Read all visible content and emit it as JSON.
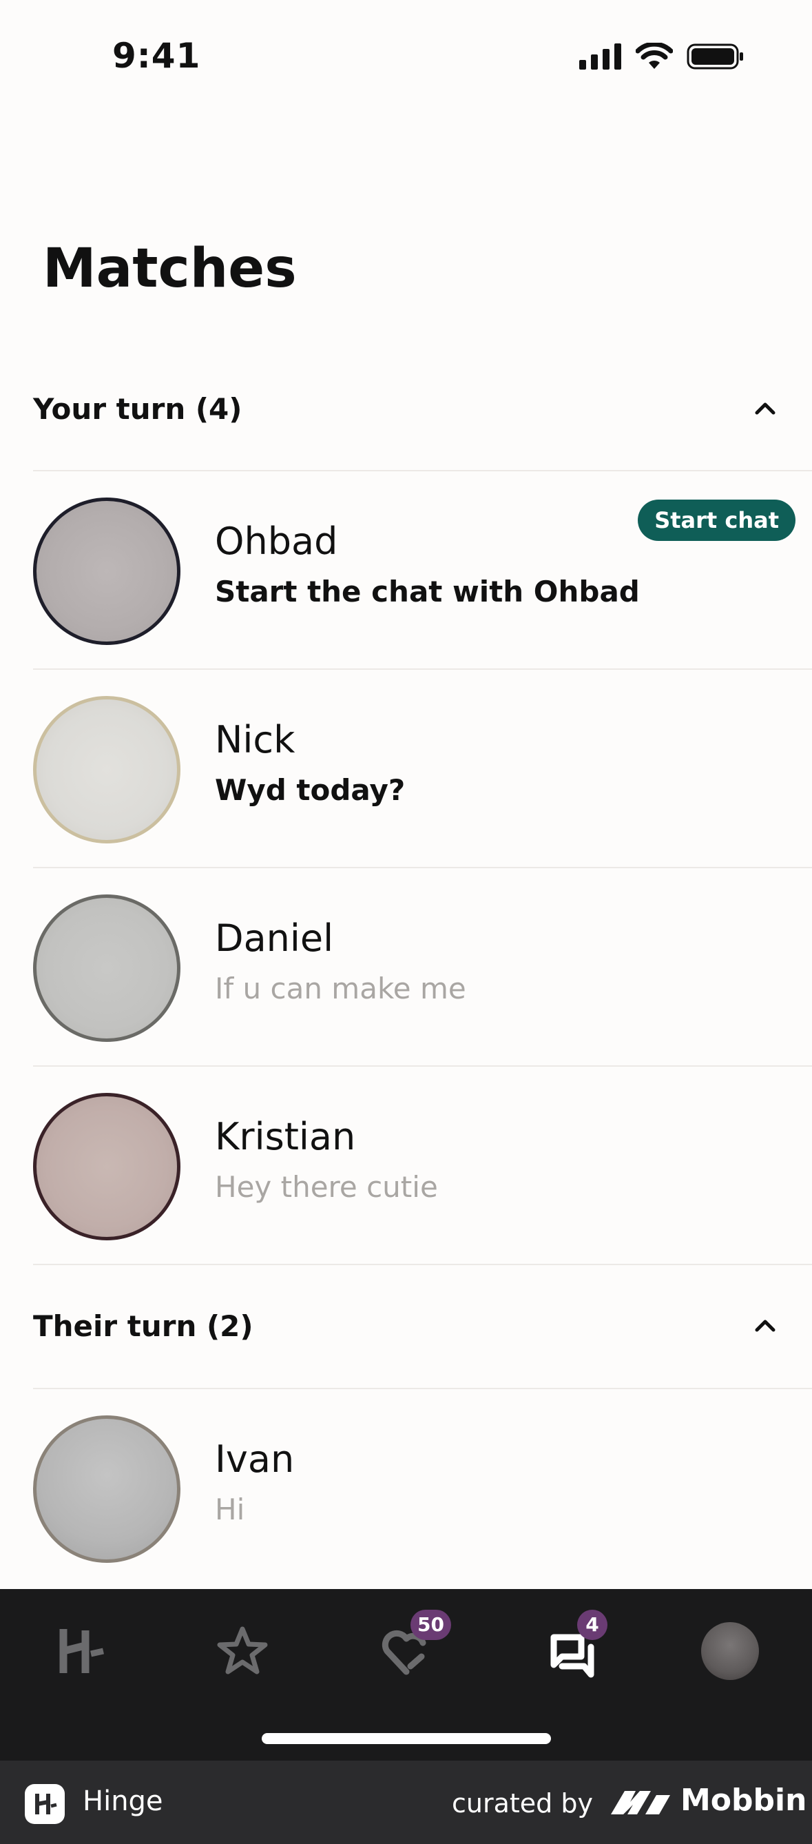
{
  "status_bar": {
    "time": "9:41"
  },
  "page": {
    "title": "Matches"
  },
  "sections": [
    {
      "label": "Your turn (4)",
      "matches": [
        {
          "name": "Ohbad",
          "preview": "Start the chat with Ohbad",
          "preview_style": "bold",
          "action": "Start chat"
        },
        {
          "name": "Nick",
          "preview": "Wyd today?",
          "preview_style": "bold"
        },
        {
          "name": "Daniel",
          "preview": "If u can make me",
          "preview_style": "muted"
        },
        {
          "name": "Kristian",
          "preview": "Hey there cutie",
          "preview_style": "muted"
        }
      ]
    },
    {
      "label": "Their turn (2)",
      "matches": [
        {
          "name": "Ivan",
          "preview": "Hi",
          "preview_style": "muted"
        }
      ]
    }
  ],
  "tab_bar": {
    "tabs": [
      {
        "icon": "hinge-home-icon"
      },
      {
        "icon": "star-icon"
      },
      {
        "icon": "likes-heart-icon",
        "badge": "50"
      },
      {
        "icon": "chat-bubbles-icon",
        "badge": "4",
        "active": true
      },
      {
        "icon": "profile-avatar"
      }
    ]
  },
  "footer": {
    "app_name": "Hinge",
    "curated_by": "curated by",
    "brand": "Mobbin"
  },
  "colors": {
    "accent": "#0f5e57",
    "badge": "#6a3b73",
    "tab_bar": "#1a1a1b",
    "background": "#fdfcfb"
  }
}
